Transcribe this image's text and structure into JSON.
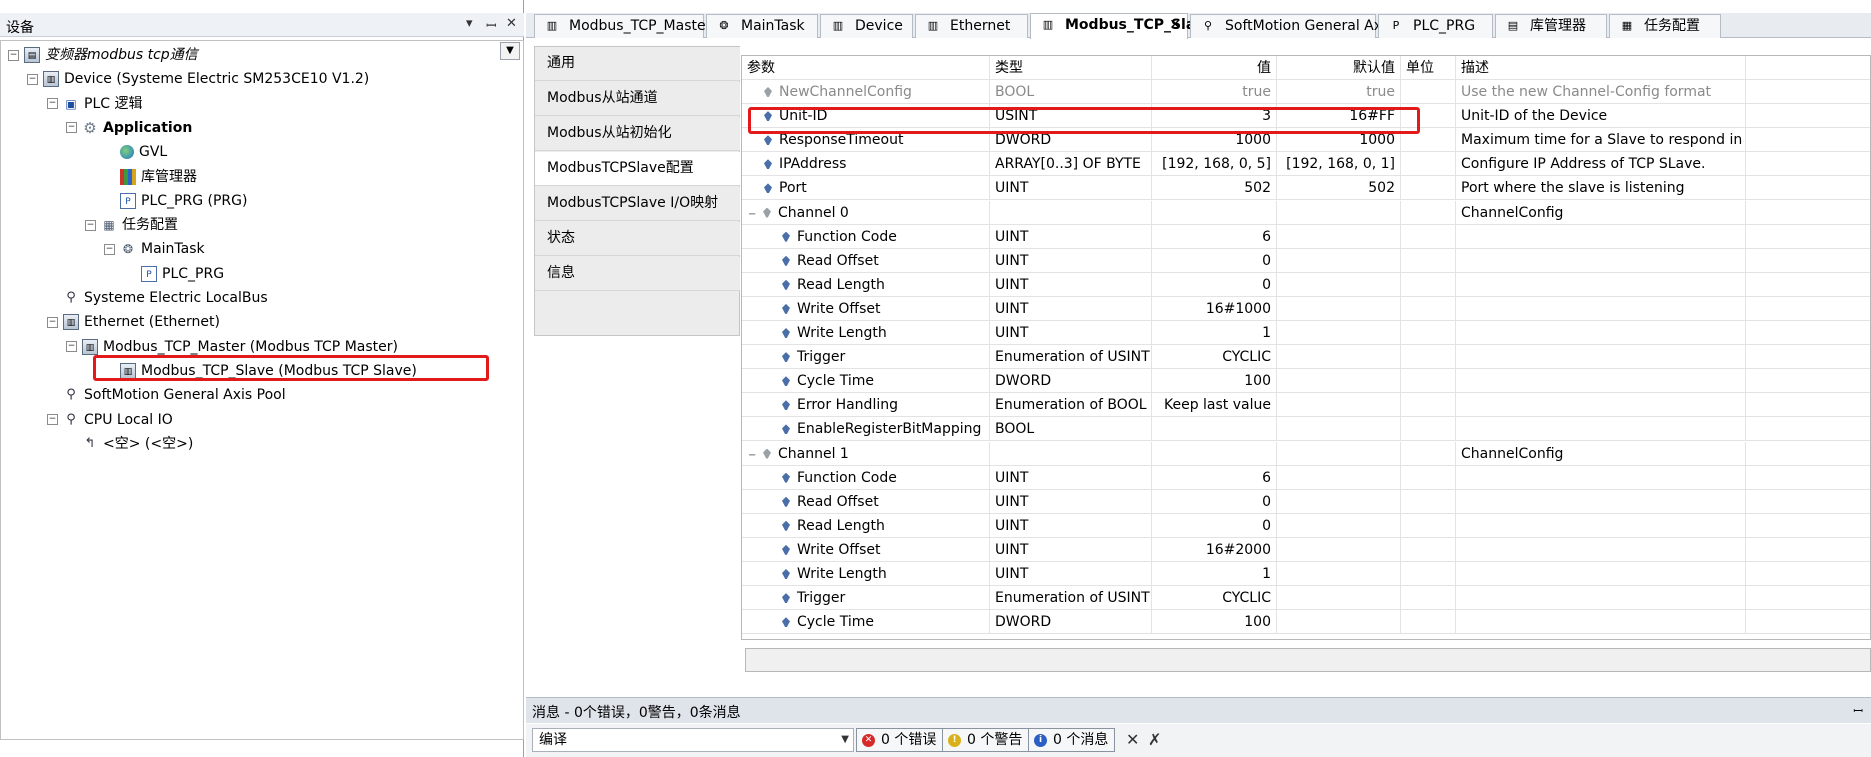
{
  "left_panel": {
    "title": "设备",
    "controls": [
      "▾",
      "ꟷ",
      "✕"
    ],
    "tree": [
      {
        "label": "变频器modbus tcp通信",
        "icon": "project-icon",
        "expander": "−"
      },
      {
        "label": "Device (Systeme Electric SM253CE10 V1.2)",
        "icon": "device-icon",
        "expander": "−"
      },
      {
        "label": "PLC 逻辑",
        "icon": "plc-logic-icon",
        "expander": "−"
      },
      {
        "label": "Application",
        "icon": "application-gear-icon",
        "expander": "−"
      },
      {
        "label": "GVL",
        "icon": "gvl-globe-icon",
        "expander": ""
      },
      {
        "label": "库管理器",
        "icon": "library-manager-icon",
        "expander": ""
      },
      {
        "label": "PLC_PRG (PRG)",
        "icon": "program-icon",
        "expander": ""
      },
      {
        "label": "任务配置",
        "icon": "task-config-icon",
        "expander": "−"
      },
      {
        "label": "MainTask",
        "icon": "task-icon",
        "expander": "−"
      },
      {
        "label": "PLC_PRG",
        "icon": "program-call-icon",
        "expander": ""
      },
      {
        "label": "Systeme Electric LocalBus",
        "icon": "bus-icon",
        "expander": ""
      },
      {
        "label": "Ethernet (Ethernet)",
        "icon": "ethernet-device-icon",
        "expander": "−"
      },
      {
        "label": "Modbus_TCP_Master (Modbus TCP Master)",
        "icon": "modbus-master-icon",
        "expander": "−"
      },
      {
        "label": "Modbus_TCP_Slave (Modbus TCP Slave)",
        "icon": "modbus-slave-icon",
        "expander": ""
      },
      {
        "label": "SoftMotion General Axis Pool",
        "icon": "axis-pool-icon",
        "expander": ""
      },
      {
        "label": "CPU Local IO",
        "icon": "cpu-io-icon",
        "expander": "−"
      },
      {
        "label": "<空> (<空>)",
        "icon": "empty-slot-icon",
        "expander": ""
      }
    ]
  },
  "doc_tabs": [
    {
      "label": "Modbus_TCP_Master",
      "icon": "device-icon",
      "active": false
    },
    {
      "label": "MainTask",
      "icon": "task-icon",
      "active": false
    },
    {
      "label": "Device",
      "icon": "device-icon",
      "active": false
    },
    {
      "label": "Ethernet",
      "icon": "device-icon",
      "active": false
    },
    {
      "label": "Modbus_TCP_Slave",
      "icon": "device-icon",
      "active": true
    },
    {
      "label": "SoftMotion General Axis Pool",
      "icon": "axis-pool-icon",
      "active": false
    },
    {
      "label": "PLC_PRG",
      "icon": "program-icon",
      "active": false
    },
    {
      "label": "库管理器",
      "icon": "library-manager-icon",
      "active": false
    },
    {
      "label": "任务配置",
      "icon": "task-config-icon",
      "active": false
    }
  ],
  "active_tab_close": "✕",
  "config_nav": [
    "通用",
    "Modbus从站通道",
    "Modbus从站初始化",
    "ModbusTCPSlave配置",
    "ModbusTCPSlave I/O映射",
    "状态",
    "信息"
  ],
  "config_nav_active": "ModbusTCPSlave配置",
  "grid": {
    "headers": {
      "param": "参数",
      "type": "类型",
      "value": "值",
      "default": "默认值",
      "unit": "单位",
      "desc": "描述"
    },
    "rows": [
      {
        "param": "NewChannelConfig",
        "type": "BOOL",
        "value": "true",
        "default": "true",
        "unit": "",
        "desc": "Use the new Channel-Config format",
        "level": 0,
        "expander": "",
        "grey": true
      },
      {
        "param": "Unit-ID",
        "type": "USINT",
        "value": "3",
        "default": "16#FF",
        "unit": "",
        "desc": "Unit-ID of the Device",
        "level": 0,
        "expander": "",
        "grey": false
      },
      {
        "param": "ResponseTimeout",
        "type": "DWORD",
        "value": "1000",
        "default": "1000",
        "unit": "",
        "desc": "Maximum time for a Slave to respond in ms",
        "level": 0,
        "expander": "",
        "grey": false
      },
      {
        "param": "IPAddress",
        "type": "ARRAY[0..3] OF BYTE",
        "value": "[192, 168, 0, 5]",
        "default": "[192, 168, 0, 1]",
        "unit": "",
        "desc": "Configure IP Address of TCP SLave.",
        "level": 0,
        "expander": "",
        "grey": false
      },
      {
        "param": "Port",
        "type": "UINT",
        "value": "502",
        "default": "502",
        "unit": "",
        "desc": "Port where the slave is listening",
        "level": 0,
        "expander": "",
        "grey": false
      },
      {
        "param": "Channel 0",
        "type": "",
        "value": "",
        "default": "",
        "unit": "",
        "desc": "ChannelConfig",
        "level": 0,
        "expander": "−",
        "grey": false
      },
      {
        "param": "Function Code",
        "type": "UINT",
        "value": "6",
        "default": "",
        "unit": "",
        "desc": "",
        "level": 1,
        "expander": "",
        "grey": false
      },
      {
        "param": "Read Offset",
        "type": "UINT",
        "value": "0",
        "default": "",
        "unit": "",
        "desc": "",
        "level": 1,
        "expander": "",
        "grey": false
      },
      {
        "param": "Read Length",
        "type": "UINT",
        "value": "0",
        "default": "",
        "unit": "",
        "desc": "",
        "level": 1,
        "expander": "",
        "grey": false
      },
      {
        "param": "Write Offset",
        "type": "UINT",
        "value": "16#1000",
        "default": "",
        "unit": "",
        "desc": "",
        "level": 1,
        "expander": "",
        "grey": false
      },
      {
        "param": "Write Length",
        "type": "UINT",
        "value": "1",
        "default": "",
        "unit": "",
        "desc": "",
        "level": 1,
        "expander": "",
        "grey": false
      },
      {
        "param": "Trigger",
        "type": "Enumeration of USINT",
        "value": "CYCLIC",
        "default": "",
        "unit": "",
        "desc": "",
        "level": 1,
        "expander": "",
        "grey": false
      },
      {
        "param": "Cycle Time",
        "type": "DWORD",
        "value": "100",
        "default": "",
        "unit": "",
        "desc": "",
        "level": 1,
        "expander": "",
        "grey": false
      },
      {
        "param": "Error Handling",
        "type": "Enumeration of BOOL",
        "value": "Keep last value",
        "default": "",
        "unit": "",
        "desc": "",
        "level": 1,
        "expander": "",
        "grey": false
      },
      {
        "param": "EnableRegisterBitMapping",
        "type": "BOOL",
        "value": "",
        "default": "",
        "unit": "",
        "desc": "",
        "level": 1,
        "expander": "",
        "grey": false
      },
      {
        "param": "Channel 1",
        "type": "",
        "value": "",
        "default": "",
        "unit": "",
        "desc": "ChannelConfig",
        "level": 0,
        "expander": "−",
        "grey": false
      },
      {
        "param": "Function Code",
        "type": "UINT",
        "value": "6",
        "default": "",
        "unit": "",
        "desc": "",
        "level": 1,
        "expander": "",
        "grey": false
      },
      {
        "param": "Read Offset",
        "type": "UINT",
        "value": "0",
        "default": "",
        "unit": "",
        "desc": "",
        "level": 1,
        "expander": "",
        "grey": false
      },
      {
        "param": "Read Length",
        "type": "UINT",
        "value": "0",
        "default": "",
        "unit": "",
        "desc": "",
        "level": 1,
        "expander": "",
        "grey": false
      },
      {
        "param": "Write Offset",
        "type": "UINT",
        "value": "16#2000",
        "default": "",
        "unit": "",
        "desc": "",
        "level": 1,
        "expander": "",
        "grey": false
      },
      {
        "param": "Write Length",
        "type": "UINT",
        "value": "1",
        "default": "",
        "unit": "",
        "desc": "",
        "level": 1,
        "expander": "",
        "grey": false
      },
      {
        "param": "Trigger",
        "type": "Enumeration of USINT",
        "value": "CYCLIC",
        "default": "",
        "unit": "",
        "desc": "",
        "level": 1,
        "expander": "",
        "grey": false
      },
      {
        "param": "Cycle Time",
        "type": "DWORD",
        "value": "100",
        "default": "",
        "unit": "",
        "desc": "",
        "level": 1,
        "expander": "",
        "grey": false
      }
    ]
  },
  "messages": {
    "title": "消息 - 0个错误，0警告，0条消息",
    "pin": "ꟷ",
    "source": "编译",
    "filters": [
      {
        "label": "0 个错误",
        "icon": "error-icon",
        "color": "#d62a2a",
        "glyph": "✕"
      },
      {
        "label": "0 个警告",
        "icon": "warning-icon",
        "color": "#d8b11a",
        "glyph": "!"
      },
      {
        "label": "0 个消息",
        "icon": "info-icon",
        "color": "#2b5fc4",
        "glyph": "i"
      }
    ],
    "clear_icon": "✕",
    "filter_clear_icon": "✗"
  },
  "highlight_color": "#e21a1a"
}
